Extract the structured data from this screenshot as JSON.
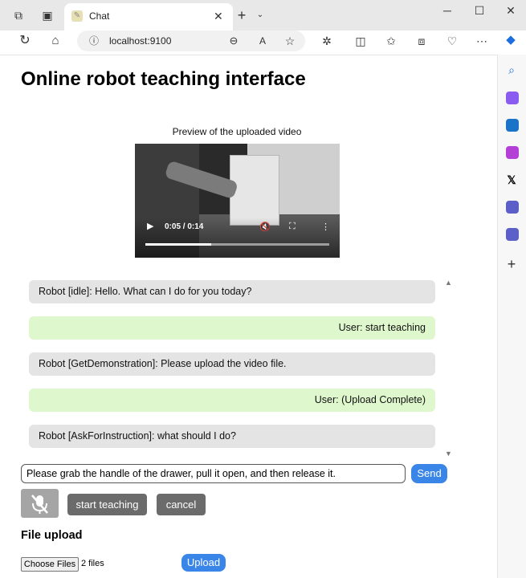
{
  "browser": {
    "tab_title": "Chat",
    "tab_favicon": "chat-favicon",
    "url": "localhost:9100",
    "accent": "#3a85e8"
  },
  "page": {
    "title": "Online robot teaching interface",
    "video": {
      "label": "Preview of the uploaded video",
      "time": "0:05 / 0:14",
      "progress_fraction": 0.357
    },
    "chat": {
      "messages": [
        {
          "role": "robot",
          "text": "Robot [idle]: Hello. What can I do for you today?"
        },
        {
          "role": "user",
          "text": "User: start teaching"
        },
        {
          "role": "robot",
          "text": "Robot [GetDemonstration]: Please upload the video file."
        },
        {
          "role": "user",
          "text": "User: (Upload Complete)"
        },
        {
          "role": "robot",
          "text": "Robot [AskForInstruction]: what should I do?"
        }
      ],
      "colors": {
        "robot_bubble": "#e4e4e4",
        "user_bubble": "#dff7cd"
      }
    },
    "input": {
      "value": "Please grab the handle of the drawer, pull it open, and then release it.",
      "send_label": "Send"
    },
    "controls": {
      "mic_icon": "microphone-off-icon",
      "start_label": "start teaching",
      "cancel_label": "cancel"
    },
    "file_upload": {
      "heading": "File upload",
      "choose_label": "Choose Files",
      "files_selected": "2 files",
      "upload_label": "Upload"
    }
  }
}
